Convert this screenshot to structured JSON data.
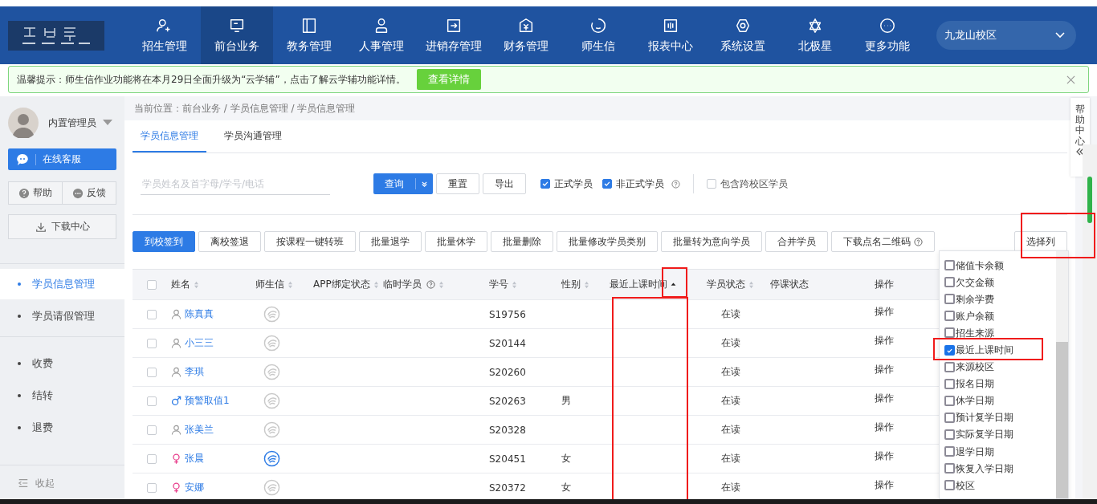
{
  "nav": {
    "items": [
      {
        "label": "招生管理",
        "selected": false
      },
      {
        "label": "前台业务",
        "selected": true
      },
      {
        "label": "教务管理",
        "selected": false
      },
      {
        "label": "人事管理",
        "selected": false
      },
      {
        "label": "进销存管理",
        "selected": false
      },
      {
        "label": "财务管理",
        "selected": false
      },
      {
        "label": "师生信",
        "selected": false
      },
      {
        "label": "报表中心",
        "selected": false
      },
      {
        "label": "系统设置",
        "selected": false
      },
      {
        "label": "北极星",
        "selected": false
      },
      {
        "label": "更多功能",
        "selected": false
      }
    ],
    "campus": "九龙山校区"
  },
  "notice": {
    "text": "温馨提示：师生信作业功能将在本月29日全面升级为“云学辅”，点击了解云学辅功能详情。",
    "button": "查看详情"
  },
  "sidebar": {
    "user": "内置管理员",
    "service": "在线客服",
    "help": "帮助",
    "feedback": "反馈",
    "download": "下载中心",
    "menu": [
      [
        {
          "label": "学员信息管理",
          "selected": true
        },
        {
          "label": "学员请假管理",
          "selected": false
        }
      ],
      [
        {
          "label": "收费",
          "selected": false
        },
        {
          "label": "结转",
          "selected": false
        },
        {
          "label": "退费",
          "selected": false
        }
      ]
    ],
    "collapse": "收起"
  },
  "breadcrumb": "当前位置：前台业务 / 学员信息管理 / 学员信息管理",
  "tabs": [
    {
      "label": "学员信息管理",
      "selected": true
    },
    {
      "label": "学员沟通管理",
      "selected": false
    }
  ],
  "search": {
    "placeholder": "学员姓名及首字母/学号/电话",
    "query": "查询",
    "reset": "重置",
    "export": "导出"
  },
  "filters": [
    {
      "label": "正式学员",
      "checked": true,
      "help": false
    },
    {
      "label": "非正式学员",
      "checked": true,
      "help": true
    },
    {
      "label": "包含跨校区学员",
      "checked": false,
      "help": false
    }
  ],
  "actions": [
    {
      "label": "到校签到",
      "primary": true,
      "help": false
    },
    {
      "label": "离校签退",
      "primary": false,
      "help": false
    },
    {
      "label": "按课程一键转班",
      "primary": false,
      "help": false
    },
    {
      "label": "批量退学",
      "primary": false,
      "help": false
    },
    {
      "label": "批量休学",
      "primary": false,
      "help": false
    },
    {
      "label": "批量删除",
      "primary": false,
      "help": false
    },
    {
      "label": "批量修改学员类别",
      "primary": false,
      "help": false
    },
    {
      "label": "批量转为意向学员",
      "primary": false,
      "help": false
    },
    {
      "label": "合并学员",
      "primary": false,
      "help": false
    },
    {
      "label": "下载点名二维码",
      "primary": false,
      "help": true
    }
  ],
  "choose_columns": "选择列",
  "table": {
    "all_checked": false,
    "columns": [
      {
        "label": "姓名",
        "sortable": true,
        "sorted": false,
        "help": false
      },
      {
        "label": "师生信",
        "sortable": true,
        "sorted": false,
        "help": false
      },
      {
        "label": "APP绑定状态",
        "sortable": true,
        "sorted": false,
        "help": false
      },
      {
        "label": "临时学员",
        "sortable": true,
        "sorted": false,
        "help": true
      },
      {
        "label": "学号",
        "sortable": true,
        "sorted": false,
        "help": false
      },
      {
        "label": "性别",
        "sortable": true,
        "sorted": false,
        "help": false
      },
      {
        "label": "最近上课时间",
        "sortable": true,
        "sorted": true,
        "help": false
      },
      {
        "label": "学员状态",
        "sortable": true,
        "sorted": false,
        "help": false
      },
      {
        "label": "停课状态",
        "sortable": false,
        "sorted": false,
        "help": false
      },
      {
        "label": "操作",
        "sortable": false,
        "sorted": false,
        "help": false
      }
    ],
    "rows": [
      {
        "checked": false,
        "kind": "unknown",
        "name": "陈真真",
        "bound": false,
        "number": "S19756",
        "sex": "",
        "status": "在读",
        "action": "操作"
      },
      {
        "checked": false,
        "kind": "unknown",
        "name": "小三三",
        "bound": false,
        "number": "S20144",
        "sex": "",
        "status": "在读",
        "action": "操作"
      },
      {
        "checked": false,
        "kind": "unknown",
        "name": "李琪",
        "bound": false,
        "number": "S20260",
        "sex": "",
        "status": "在读",
        "action": "操作"
      },
      {
        "checked": false,
        "kind": "male",
        "name": "预警取值1",
        "bound": false,
        "number": "S20263",
        "sex": "男",
        "status": "在读",
        "action": "操作"
      },
      {
        "checked": false,
        "kind": "unknown",
        "name": "张美兰",
        "bound": false,
        "number": "S20328",
        "sex": "",
        "status": "在读",
        "action": "操作"
      },
      {
        "checked": false,
        "kind": "female",
        "name": "张晨",
        "bound": true,
        "number": "S20451",
        "sex": "女",
        "status": "在读",
        "action": "操作"
      },
      {
        "checked": false,
        "kind": "female",
        "name": "安娜",
        "bound": false,
        "number": "S20372",
        "sex": "女",
        "status": "在读",
        "action": "操作"
      }
    ]
  },
  "column_menu": [
    {
      "label": "储值卡余额",
      "checked": false
    },
    {
      "label": "欠交金额",
      "checked": false
    },
    {
      "label": "剩余学费",
      "checked": false
    },
    {
      "label": "账户余额",
      "checked": false
    },
    {
      "label": "招生来源",
      "checked": false
    },
    {
      "label": "最近上课时间",
      "checked": true
    },
    {
      "label": "来源校区",
      "checked": false
    },
    {
      "label": "报名日期",
      "checked": false
    },
    {
      "label": "休学日期",
      "checked": false
    },
    {
      "label": "预计复学日期",
      "checked": false
    },
    {
      "label": "实际复学日期",
      "checked": false
    },
    {
      "label": "退学日期",
      "checked": false
    },
    {
      "label": "恢复入学日期",
      "checked": false
    },
    {
      "label": "校区",
      "checked": false
    }
  ],
  "help_center": "帮助中心"
}
